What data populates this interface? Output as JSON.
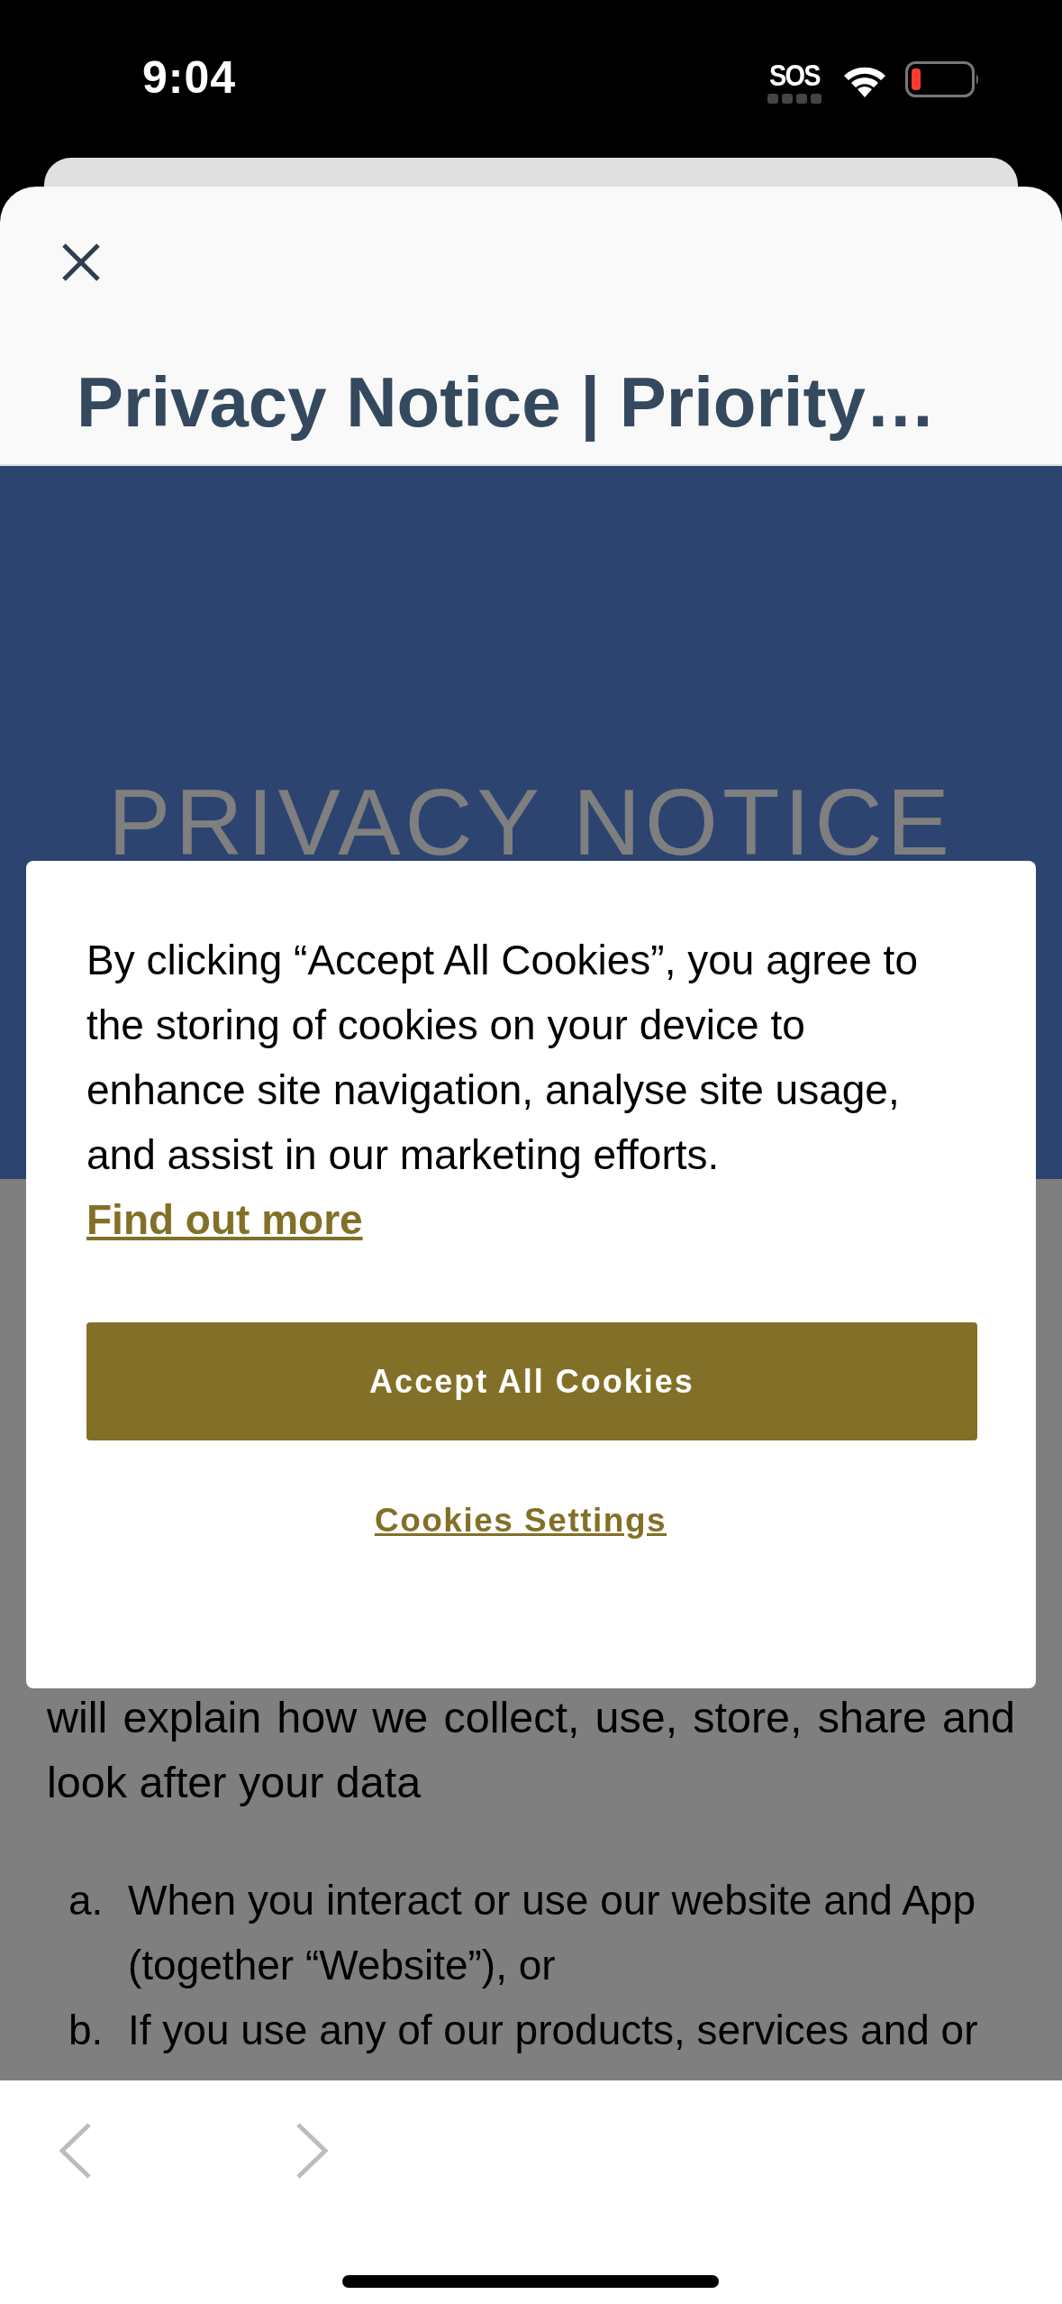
{
  "status_bar": {
    "time": "9:04",
    "carrier": "SOS"
  },
  "sheet": {
    "title": "Privacy Notice | Priority…"
  },
  "page": {
    "hero_title": "PRIVACY NOTICE",
    "intro": {
      "text": "will explain how we collect, use, store, share and look after your data"
    },
    "list": [
      {
        "marker": "a.",
        "text": "When you interact or use our website and App (together “Website”), or"
      },
      {
        "marker": "b.",
        "text": "If you use any of our products, services and or"
      }
    ]
  },
  "cookie_dialog": {
    "message": "By clicking “Accept All Cookies”, you agree to the storing of cookies on your device to enhance site navigation, analyse site usage, and assist in our marketing efforts.",
    "link": "Find out more",
    "accept_button": "Accept All Cookies",
    "settings_link": "Cookies Settings"
  }
}
